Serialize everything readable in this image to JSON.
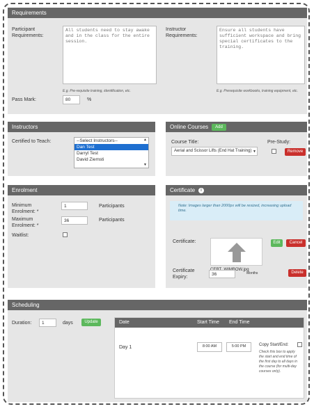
{
  "requirements": {
    "header": "Requirements",
    "participant_label": "Participant Requirements:",
    "participant_placeholder": "All students need to stay awake and in the class for the entire session.",
    "participant_hint": "E.g. Pre-requisite training, identification, etc.",
    "instructor_label": "Instructor Requirements:",
    "instructor_placeholder": "Ensure all students have sufficient workspace and bring special certificates to the training.",
    "instructor_hint": "E.g. Prerequisite workbooks, training equipment, etc.",
    "pass_mark_label": "Pass Mark:",
    "pass_mark_value": "80",
    "pass_mark_unit": "%"
  },
  "instructors": {
    "header": "Instructors",
    "certified_label": "Certified to Teach:",
    "options": [
      "--Select Instructors--",
      "Dan Test",
      "Darryl Test",
      "David Ziemsti"
    ]
  },
  "online_courses": {
    "header": "Online Courses",
    "add_label": "Add",
    "course_title_label": "Course Title:",
    "course_value": "Aerial and Scissor Lifts (End Hat Training)",
    "prestudy_label": "Pre-Study:",
    "remove_label": "Remove"
  },
  "enrolment": {
    "header": "Enrolment",
    "min_label": "Minimum Enrolment: *",
    "min_value": "1",
    "min_unit": "Participants",
    "max_label": "Maximum Enrolment: *",
    "max_value": "36",
    "max_unit": "Participants",
    "waitlist_label": "Waitlist:"
  },
  "certificate": {
    "header": "Certificate",
    "info_text": "Note: Images larger than 2000px will be resized, increasing upload time.",
    "cert_label": "Certificate:",
    "edit_label": "Edit",
    "cancel_label": "Cancel",
    "filename": "CERT_WIMBOW.jpg",
    "expiry_label": "Certificate Expiry:",
    "expiry_value": "36",
    "expiry_unit": "Months",
    "delete_label": "Delete"
  },
  "scheduling": {
    "header": "Scheduling",
    "duration_label": "Duration:",
    "duration_value": "1",
    "duration_unit": "days",
    "update_label": "Update",
    "col_date": "Date",
    "col_start": "Start Time",
    "col_end": "End Time",
    "row_day": "Day 1",
    "row_start": "8:00 AM",
    "row_end": "5:00 PM",
    "copy_label": "Copy Start/End:",
    "copy_help": "Check this box to apply the start and end time of the first day to all days in the course (for multi-day courses only)."
  },
  "colors": {
    "panel_header": "#666666",
    "panel_bg": "#e6e6e6",
    "accent_green": "#5cb85c",
    "accent_red": "#c9302c",
    "select_blue": "#1e6fd0",
    "info_bg": "#d9edf7"
  }
}
